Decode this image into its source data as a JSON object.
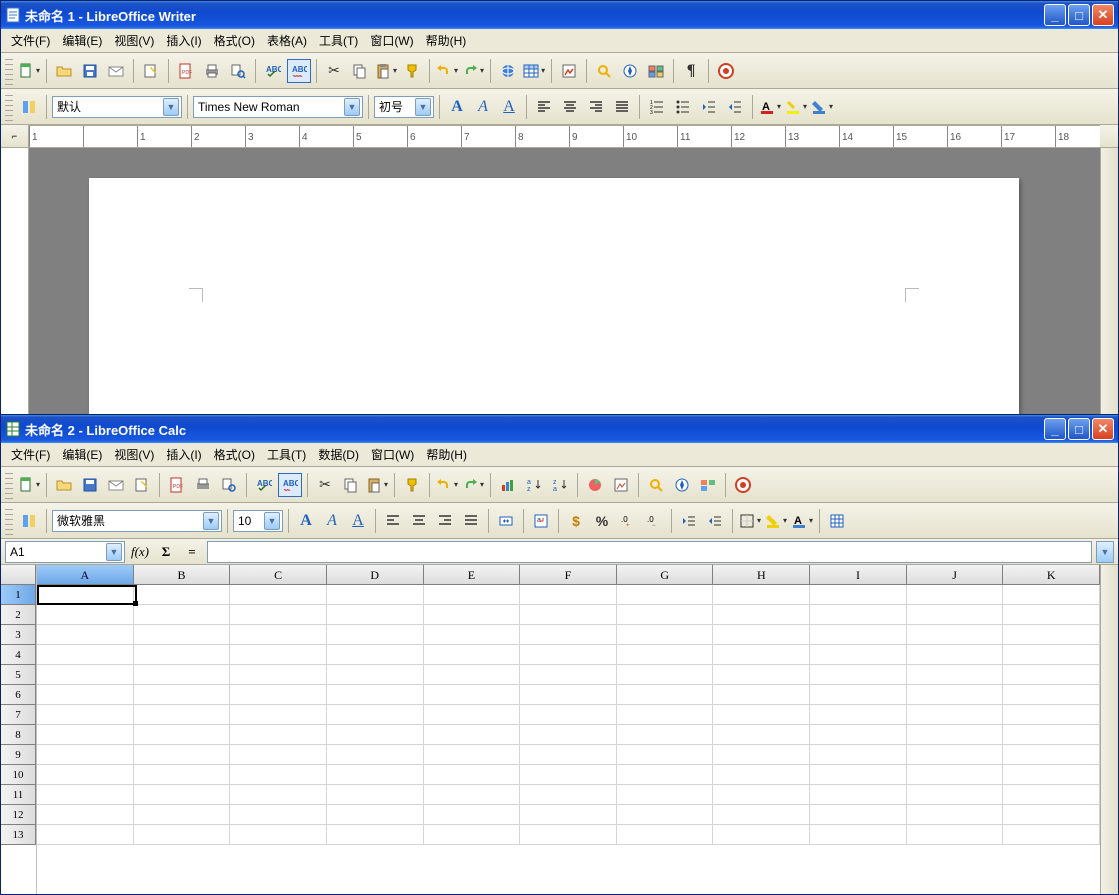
{
  "writer": {
    "title": "未命名 1 - LibreOffice Writer",
    "menus": [
      "文件(F)",
      "编辑(E)",
      "视图(V)",
      "插入(I)",
      "格式(O)",
      "表格(A)",
      "工具(T)",
      "窗口(W)",
      "帮助(H)"
    ],
    "style_combo": "默认",
    "font_combo": "Times New Roman",
    "size_combo": "初号",
    "ruler_ticks": [
      "1",
      "",
      "1",
      "2",
      "3",
      "4",
      "5",
      "6",
      "7",
      "8",
      "9",
      "10",
      "11",
      "12",
      "13",
      "14",
      "15",
      "16",
      "17",
      "18"
    ]
  },
  "calc": {
    "title": "未命名 2 - LibreOffice Calc",
    "menus": [
      "文件(F)",
      "编辑(E)",
      "视图(V)",
      "插入(I)",
      "格式(O)",
      "工具(T)",
      "数据(D)",
      "窗口(W)",
      "帮助(H)"
    ],
    "font_combo": "微软雅黑",
    "size_combo": "10",
    "cell_ref": "A1",
    "fx_label": "f(x)",
    "sigma": "Σ",
    "eq": "=",
    "columns": [
      "A",
      "B",
      "C",
      "D",
      "E",
      "F",
      "G",
      "H",
      "I",
      "J",
      "K"
    ],
    "rows": [
      "1",
      "2",
      "3",
      "4",
      "5",
      "6",
      "7",
      "8",
      "9",
      "10",
      "11",
      "12",
      "13"
    ],
    "selected_col": "A",
    "selected_row": "1",
    "pct": "%",
    "currency_icon": "$"
  },
  "win_controls": {
    "min": "_",
    "max": "□",
    "close": "✕"
  }
}
